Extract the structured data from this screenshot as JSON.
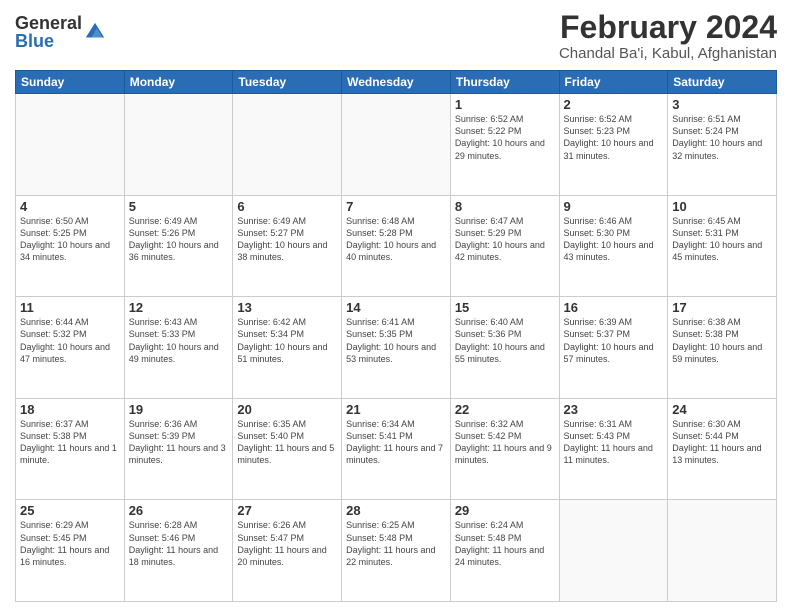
{
  "header": {
    "logo_general": "General",
    "logo_blue": "Blue",
    "month_year": "February 2024",
    "location": "Chandal Ba'i, Kabul, Afghanistan"
  },
  "weekdays": [
    "Sunday",
    "Monday",
    "Tuesday",
    "Wednesday",
    "Thursday",
    "Friday",
    "Saturday"
  ],
  "weeks": [
    [
      {
        "day": "",
        "info": ""
      },
      {
        "day": "",
        "info": ""
      },
      {
        "day": "",
        "info": ""
      },
      {
        "day": "",
        "info": ""
      },
      {
        "day": "1",
        "info": "Sunrise: 6:52 AM\nSunset: 5:22 PM\nDaylight: 10 hours\nand 29 minutes."
      },
      {
        "day": "2",
        "info": "Sunrise: 6:52 AM\nSunset: 5:23 PM\nDaylight: 10 hours\nand 31 minutes."
      },
      {
        "day": "3",
        "info": "Sunrise: 6:51 AM\nSunset: 5:24 PM\nDaylight: 10 hours\nand 32 minutes."
      }
    ],
    [
      {
        "day": "4",
        "info": "Sunrise: 6:50 AM\nSunset: 5:25 PM\nDaylight: 10 hours\nand 34 minutes."
      },
      {
        "day": "5",
        "info": "Sunrise: 6:49 AM\nSunset: 5:26 PM\nDaylight: 10 hours\nand 36 minutes."
      },
      {
        "day": "6",
        "info": "Sunrise: 6:49 AM\nSunset: 5:27 PM\nDaylight: 10 hours\nand 38 minutes."
      },
      {
        "day": "7",
        "info": "Sunrise: 6:48 AM\nSunset: 5:28 PM\nDaylight: 10 hours\nand 40 minutes."
      },
      {
        "day": "8",
        "info": "Sunrise: 6:47 AM\nSunset: 5:29 PM\nDaylight: 10 hours\nand 42 minutes."
      },
      {
        "day": "9",
        "info": "Sunrise: 6:46 AM\nSunset: 5:30 PM\nDaylight: 10 hours\nand 43 minutes."
      },
      {
        "day": "10",
        "info": "Sunrise: 6:45 AM\nSunset: 5:31 PM\nDaylight: 10 hours\nand 45 minutes."
      }
    ],
    [
      {
        "day": "11",
        "info": "Sunrise: 6:44 AM\nSunset: 5:32 PM\nDaylight: 10 hours\nand 47 minutes."
      },
      {
        "day": "12",
        "info": "Sunrise: 6:43 AM\nSunset: 5:33 PM\nDaylight: 10 hours\nand 49 minutes."
      },
      {
        "day": "13",
        "info": "Sunrise: 6:42 AM\nSunset: 5:34 PM\nDaylight: 10 hours\nand 51 minutes."
      },
      {
        "day": "14",
        "info": "Sunrise: 6:41 AM\nSunset: 5:35 PM\nDaylight: 10 hours\nand 53 minutes."
      },
      {
        "day": "15",
        "info": "Sunrise: 6:40 AM\nSunset: 5:36 PM\nDaylight: 10 hours\nand 55 minutes."
      },
      {
        "day": "16",
        "info": "Sunrise: 6:39 AM\nSunset: 5:37 PM\nDaylight: 10 hours\nand 57 minutes."
      },
      {
        "day": "17",
        "info": "Sunrise: 6:38 AM\nSunset: 5:38 PM\nDaylight: 10 hours\nand 59 minutes."
      }
    ],
    [
      {
        "day": "18",
        "info": "Sunrise: 6:37 AM\nSunset: 5:38 PM\nDaylight: 11 hours\nand 1 minute."
      },
      {
        "day": "19",
        "info": "Sunrise: 6:36 AM\nSunset: 5:39 PM\nDaylight: 11 hours\nand 3 minutes."
      },
      {
        "day": "20",
        "info": "Sunrise: 6:35 AM\nSunset: 5:40 PM\nDaylight: 11 hours\nand 5 minutes."
      },
      {
        "day": "21",
        "info": "Sunrise: 6:34 AM\nSunset: 5:41 PM\nDaylight: 11 hours\nand 7 minutes."
      },
      {
        "day": "22",
        "info": "Sunrise: 6:32 AM\nSunset: 5:42 PM\nDaylight: 11 hours\nand 9 minutes."
      },
      {
        "day": "23",
        "info": "Sunrise: 6:31 AM\nSunset: 5:43 PM\nDaylight: 11 hours\nand 11 minutes."
      },
      {
        "day": "24",
        "info": "Sunrise: 6:30 AM\nSunset: 5:44 PM\nDaylight: 11 hours\nand 13 minutes."
      }
    ],
    [
      {
        "day": "25",
        "info": "Sunrise: 6:29 AM\nSunset: 5:45 PM\nDaylight: 11 hours\nand 16 minutes."
      },
      {
        "day": "26",
        "info": "Sunrise: 6:28 AM\nSunset: 5:46 PM\nDaylight: 11 hours\nand 18 minutes."
      },
      {
        "day": "27",
        "info": "Sunrise: 6:26 AM\nSunset: 5:47 PM\nDaylight: 11 hours\nand 20 minutes."
      },
      {
        "day": "28",
        "info": "Sunrise: 6:25 AM\nSunset: 5:48 PM\nDaylight: 11 hours\nand 22 minutes."
      },
      {
        "day": "29",
        "info": "Sunrise: 6:24 AM\nSunset: 5:48 PM\nDaylight: 11 hours\nand 24 minutes."
      },
      {
        "day": "",
        "info": ""
      },
      {
        "day": "",
        "info": ""
      }
    ]
  ]
}
